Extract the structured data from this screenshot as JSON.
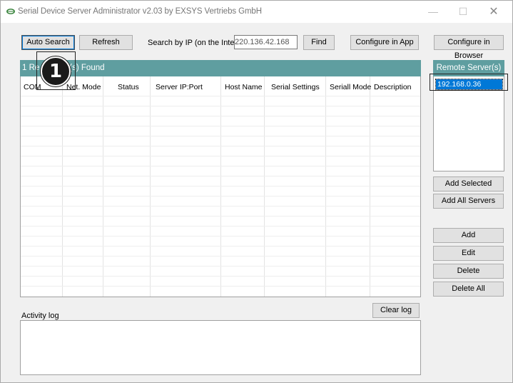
{
  "window": {
    "title": "Serial Device Server Administrator v2.03 by EXSYS Vertriebs GmbH",
    "controls": {
      "minimize": "—",
      "maximize": "☐",
      "close": "✕"
    }
  },
  "toolbar": {
    "auto_search": "Auto Search",
    "refresh": "Refresh",
    "search_ip_label": "Search by IP (on the Internet):",
    "search_ip_value": "220.136.42.168",
    "find": "Find",
    "configure_app": "Configure in App",
    "configure_browser": "Configure in Browser"
  },
  "results": {
    "header_left": "1 Re",
    "header_right": "(s) Found",
    "columns": [
      "COM",
      "Net. Mode",
      "Status",
      "Server IP:Port",
      "Host Name",
      "Serial Settings",
      "Seriall Mode",
      "Description"
    ],
    "rows": []
  },
  "badge": {
    "number": "1"
  },
  "remote": {
    "header": "Remote Server(s)",
    "items": [
      "192.168.0.36"
    ],
    "selected_index": 0
  },
  "side_buttons": {
    "add_selected": "Add Selected Server",
    "add_all": "Add All Servers",
    "add": "Add",
    "edit": "Edit",
    "delete": "Delete",
    "delete_all": "Delete All"
  },
  "log": {
    "label": "Activity log",
    "clear": "Clear log",
    "content": ""
  },
  "colors": {
    "header_bg": "#5f9ea0",
    "selection_bg": "#0078d7",
    "window_bg": "#f0f0f0"
  }
}
